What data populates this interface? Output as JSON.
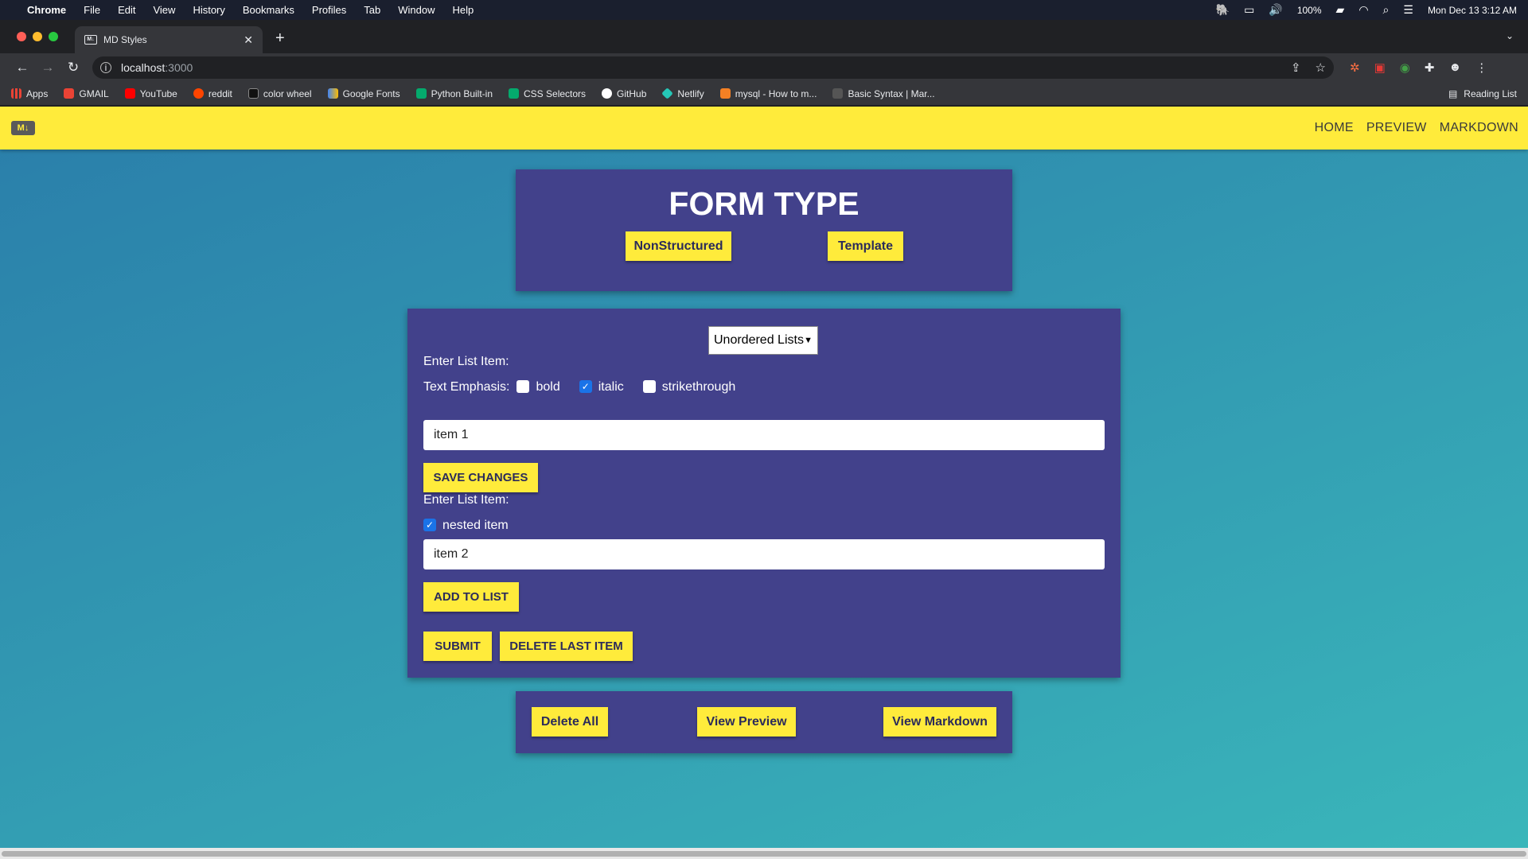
{
  "menubar": {
    "app": "Chrome",
    "items": [
      "File",
      "Edit",
      "View",
      "History",
      "Bookmarks",
      "Profiles",
      "Tab",
      "Window",
      "Help"
    ],
    "battery": "100%",
    "datetime": "Mon Dec 13  3:12 AM"
  },
  "browser": {
    "tab_title": "MD Styles",
    "url_host": "localhost",
    "url_port": ":3000",
    "bookmarks": [
      {
        "label": "Apps",
        "icon": "grid-icon",
        "color": "#ea4335"
      },
      {
        "label": "GMAIL",
        "icon": "gmail-icon",
        "color": "#ea4335"
      },
      {
        "label": "YouTube",
        "icon": "youtube-icon",
        "color": "#ff0000"
      },
      {
        "label": "reddit",
        "icon": "reddit-icon",
        "color": "#ff4500"
      },
      {
        "label": "color wheel",
        "icon": "color-wheel-icon",
        "color": "#111111"
      },
      {
        "label": "Google Fonts",
        "icon": "google-fonts-icon",
        "color": "#4285f4"
      },
      {
        "label": "Python Built-in",
        "icon": "w3-icon",
        "color": "#04aa6d"
      },
      {
        "label": "CSS Selectors",
        "icon": "w3-icon",
        "color": "#04aa6d"
      },
      {
        "label": "GitHub",
        "icon": "github-icon",
        "color": "#ffffff"
      },
      {
        "label": "Netlify",
        "icon": "netlify-icon",
        "color": "#25c7b7"
      },
      {
        "label": "mysql - How to m...",
        "icon": "stackoverflow-icon",
        "color": "#f48024"
      },
      {
        "label": "Basic Syntax | Mar...",
        "icon": "markdown-icon",
        "color": "#555555"
      }
    ],
    "reading_list": "Reading List"
  },
  "site": {
    "logo": "M↓",
    "nav": {
      "home": "HOME",
      "preview": "PREVIEW",
      "markdown": "MARKDOWN"
    },
    "brand_yellow": "#ffeb3b",
    "card_color": "#42418b"
  },
  "form_type": {
    "title": "FORM TYPE",
    "nonstructured": "NonStructured",
    "template": "Template"
  },
  "form": {
    "select_value": "Unordered Lists",
    "enter_label_1": "Enter List Item:",
    "emphasis_label": "Text Emphasis:",
    "emphasis": {
      "bold": {
        "label": "bold",
        "checked": false
      },
      "italic": {
        "label": "italic",
        "checked": true
      },
      "strikethrough": {
        "label": "strikethrough",
        "checked": false
      }
    },
    "item_1_value": "item 1",
    "save_changes": "SAVE CHANGES",
    "enter_label_2": "Enter List Item:",
    "nested": {
      "label": "nested item",
      "checked": true
    },
    "item_2_value": "item 2",
    "add_to_list": "ADD TO LIST",
    "submit": "SUBMIT",
    "delete_last": "DELETE LAST ITEM"
  },
  "actions": {
    "delete_all": "Delete All",
    "view_preview": "View Preview",
    "view_markdown": "View Markdown"
  }
}
